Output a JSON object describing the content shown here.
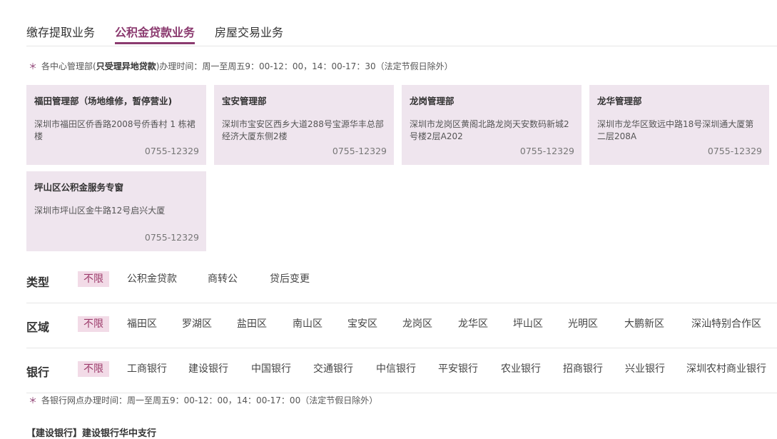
{
  "tabs": [
    {
      "label": "缴存提取业务",
      "active": false
    },
    {
      "label": "公积金贷款业务",
      "active": true
    },
    {
      "label": "房屋交易业务",
      "active": false
    }
  ],
  "center_note": {
    "star": "＊",
    "prefix": "各中心管理部(",
    "bold": "只受理异地贷款",
    "suffix": ")办理时间：周一至周五9：00-12：00，14：00-17：30（法定节假日除外）"
  },
  "offices": [
    {
      "name": "福田管理部（场地维修，暂停营业)",
      "address": "深圳市福田区侨香路2008号侨香村 1 栋裙楼",
      "phone": "0755-12329"
    },
    {
      "name": "宝安管理部",
      "address": "深圳市宝安区西乡大道288号宝源华丰总部经济大厦东侧2楼",
      "phone": "0755-12329"
    },
    {
      "name": "龙岗管理部",
      "address": "深圳市龙岗区黄阁北路龙岗天安数码新城2号楼2层A202",
      "phone": "0755-12329"
    },
    {
      "name": "龙华管理部",
      "address": "深圳市龙华区致远中路18号深圳通大厦第二层208A",
      "phone": "0755-12329"
    },
    {
      "name": "坪山区公积金服务专窗",
      "address": "深圳市坪山区金牛路12号启兴大厦",
      "phone": "0755-12329"
    }
  ],
  "filters": {
    "type": {
      "label": "类型",
      "options": [
        "不限",
        "公积金贷款",
        "商转公",
        "贷后变更"
      ],
      "selected": 0
    },
    "region": {
      "label": "区域",
      "options": [
        "不限",
        "福田区",
        "罗湖区",
        "盐田区",
        "南山区",
        "宝安区",
        "龙岗区",
        "龙华区",
        "坪山区",
        "光明区",
        "大鹏新区",
        "深汕特别合作区"
      ],
      "selected": 0
    },
    "bank": {
      "label": "银行",
      "options": [
        "不限",
        "工商银行",
        "建设银行",
        "中国银行",
        "交通银行",
        "中信银行",
        "平安银行",
        "农业银行",
        "招商银行",
        "兴业银行",
        "深圳农村商业银行"
      ],
      "selected": 0
    }
  },
  "bank_note": {
    "star": "＊",
    "text": "各银行网点办理时间：周一至周五9：00-12：00，14：00-17：00（法定节假日除外）"
  },
  "bottom_text": "【建设银行】建设银行华中支行",
  "colors": {
    "accent": "#8b3a6f",
    "card_bg": "#efe5ee",
    "tag_bg": "#f2dbe7"
  }
}
